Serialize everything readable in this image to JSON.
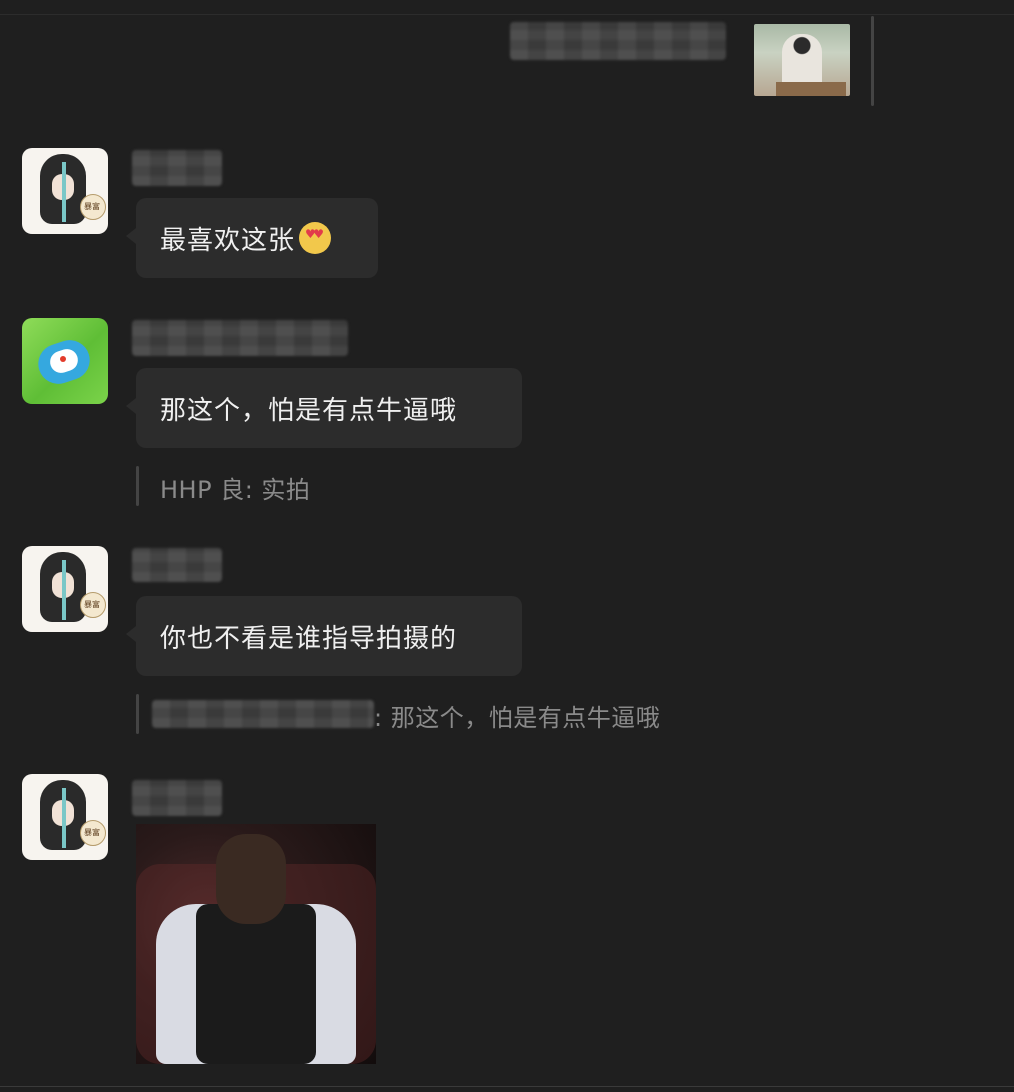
{
  "avatars": {
    "girl_fan_text": "暴富"
  },
  "messages": [
    {
      "text": "最喜欢这张"
    },
    {
      "text": "那这个，怕是有点牛逼哦",
      "quote": "HHP 良: 实拍"
    },
    {
      "text": "你也不看是谁指导拍摄的",
      "quote_suffix": ": 那这个，怕是有点牛逼哦"
    }
  ]
}
